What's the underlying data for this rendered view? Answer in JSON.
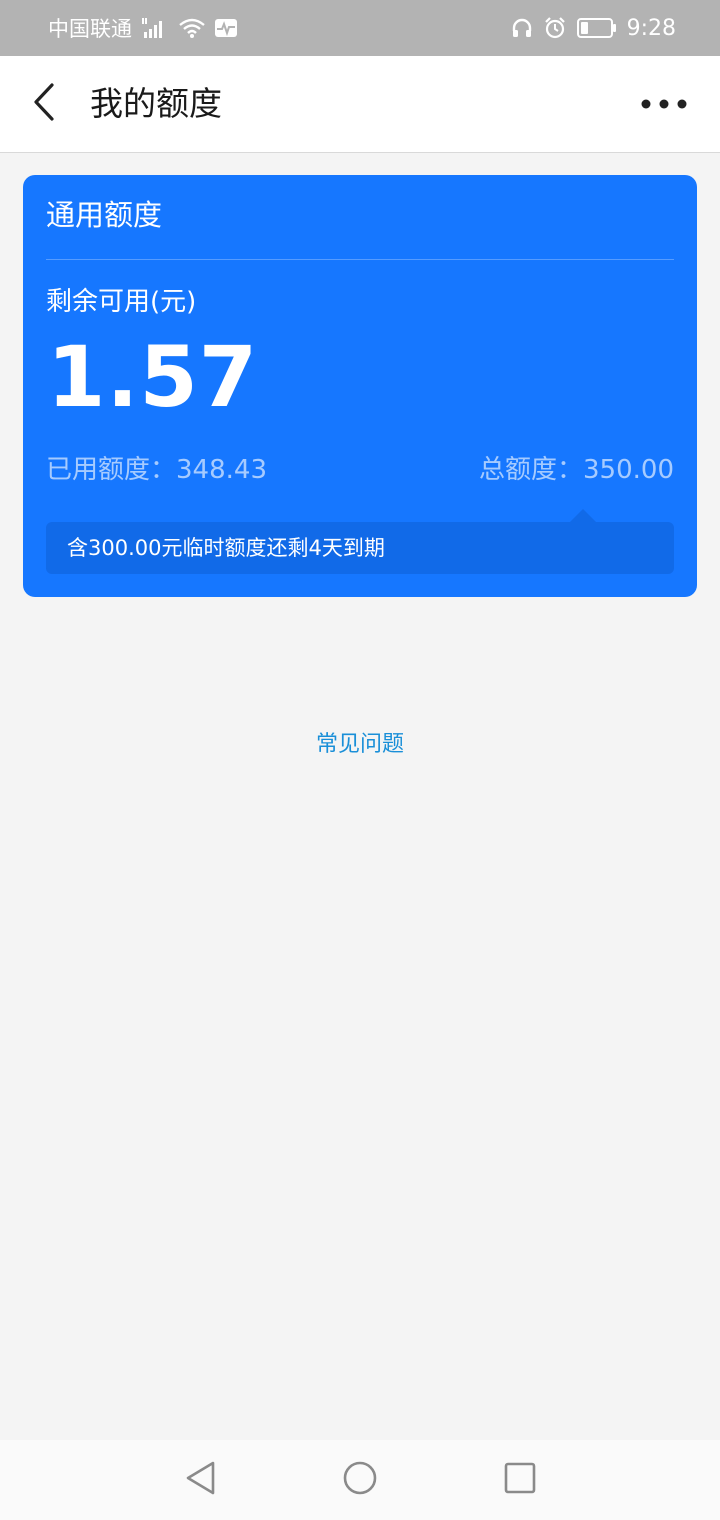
{
  "status_bar": {
    "carrier": "中国联通",
    "time": "9:28",
    "icons": [
      "signal-icon",
      "wifi-icon",
      "activity-icon",
      "headphones-icon",
      "alarm-icon",
      "battery-icon"
    ],
    "battery_level": 0.25
  },
  "header": {
    "title": "我的额度",
    "back_icon": "chevron-left-icon",
    "more_icon": "more-dots-icon"
  },
  "quota_card": {
    "title": "通用额度",
    "remaining_label": "剩余可用(元)",
    "remaining_amount": "1.57",
    "used_label": "已用额度：",
    "used_value": "348.43",
    "total_label": "总额度：",
    "total_value": "350.00",
    "temp_note": "含300.00元临时额度还剩4天到期",
    "color": "#1677ff"
  },
  "faq_link": "常见问题",
  "navigation_bar": {
    "icons": [
      "back-triangle-icon",
      "home-circle-icon",
      "recents-square-icon"
    ]
  }
}
